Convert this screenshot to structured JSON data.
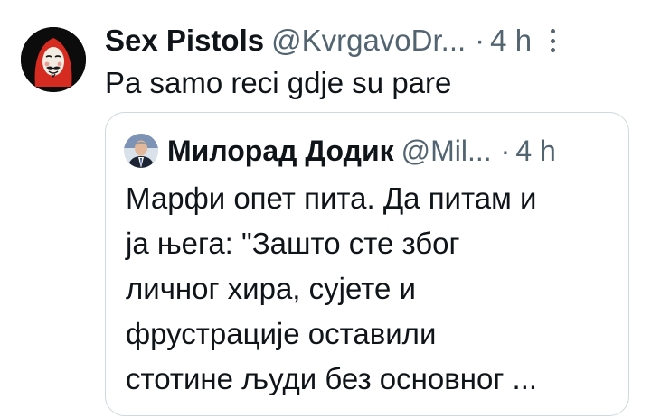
{
  "tweet": {
    "display_name": "Sex Pistols",
    "handle": "@KvrgavoDr...",
    "separator": "·",
    "time": "4 h",
    "text": "Pa samo reci gdje su pare",
    "avatar_icon": "money-heist-mask-icon",
    "more_icon": "more-options-icon"
  },
  "quote": {
    "display_name": "Милорад Додик",
    "handle": "@Mil...",
    "separator": "·",
    "time": "4 h",
    "avatar_icon": "profile-photo-icon",
    "text_lines": [
      "Марфи опет пита. Да питам и",
      "ја њега: \"Зашто сте због",
      "личног хира, сујете и",
      "фрустрације оставили",
      "стотине људи без основног ..."
    ]
  },
  "colors": {
    "text_primary": "#0f1419",
    "text_secondary": "#536471",
    "card_border": "#cfd9de",
    "avatar_bg": "#0c0c0c",
    "mask_red": "#d62b20"
  }
}
